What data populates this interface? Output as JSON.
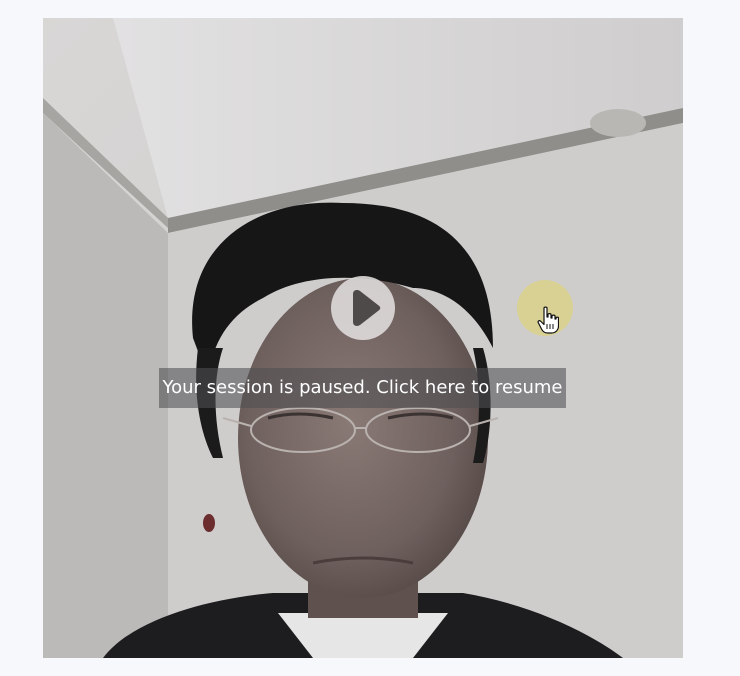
{
  "session": {
    "paused_message": "Your session is paused. Click here to resume"
  },
  "icons": {
    "play": "play-icon",
    "cursor": "hand-pointer-icon"
  },
  "colors": {
    "page_background": "#f7f8fb",
    "banner_background": "#505052",
    "banner_text": "#ffffff",
    "click_highlight": "#e0d564"
  }
}
